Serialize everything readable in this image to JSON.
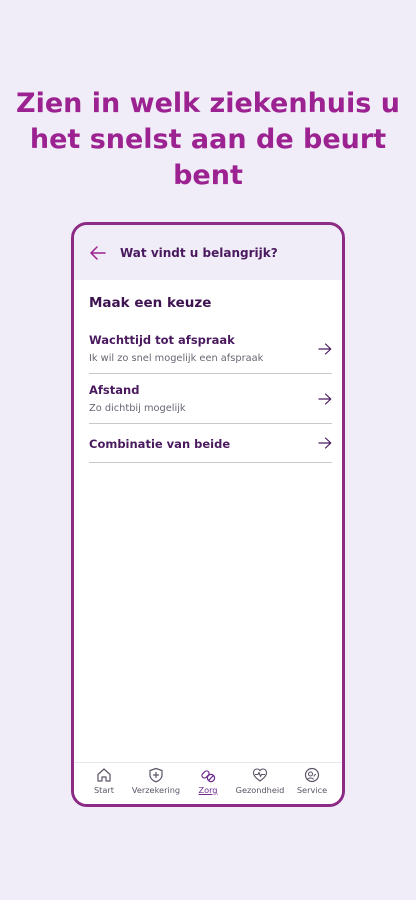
{
  "headline": {
    "line1": "Zien in welk ziekenhuis u",
    "line2": "het snelst aan de beurt bent"
  },
  "appbar": {
    "title": "Wat vindt u belangrijk?",
    "back_icon": "arrow-left-icon"
  },
  "section": {
    "title": "Maak een keuze"
  },
  "options": [
    {
      "label": "Wachttijd tot afspraak",
      "sub": "Ik wil zo snel mogelijk een afspraak",
      "icon": "arrow-right-icon"
    },
    {
      "label": "Afstand",
      "sub": "Zo dichtbij mogelijk",
      "icon": "arrow-right-icon"
    },
    {
      "label": "Combinatie van beide",
      "icon": "arrow-right-icon"
    }
  ],
  "bottom_nav": {
    "items": [
      {
        "label": "Start",
        "icon": "home-icon"
      },
      {
        "label": "Verzekering",
        "icon": "shield-plus-icon"
      },
      {
        "label": "Zorg",
        "icon": "pills-icon",
        "active": true
      },
      {
        "label": "Gezondheid",
        "icon": "heartbeat-icon"
      },
      {
        "label": "Service",
        "icon": "support-icon"
      }
    ]
  },
  "colors": {
    "accent": "#9b2290",
    "frame": "#8c2a85",
    "primary_text": "#4a1a5e",
    "background": "#f0ecf8"
  }
}
